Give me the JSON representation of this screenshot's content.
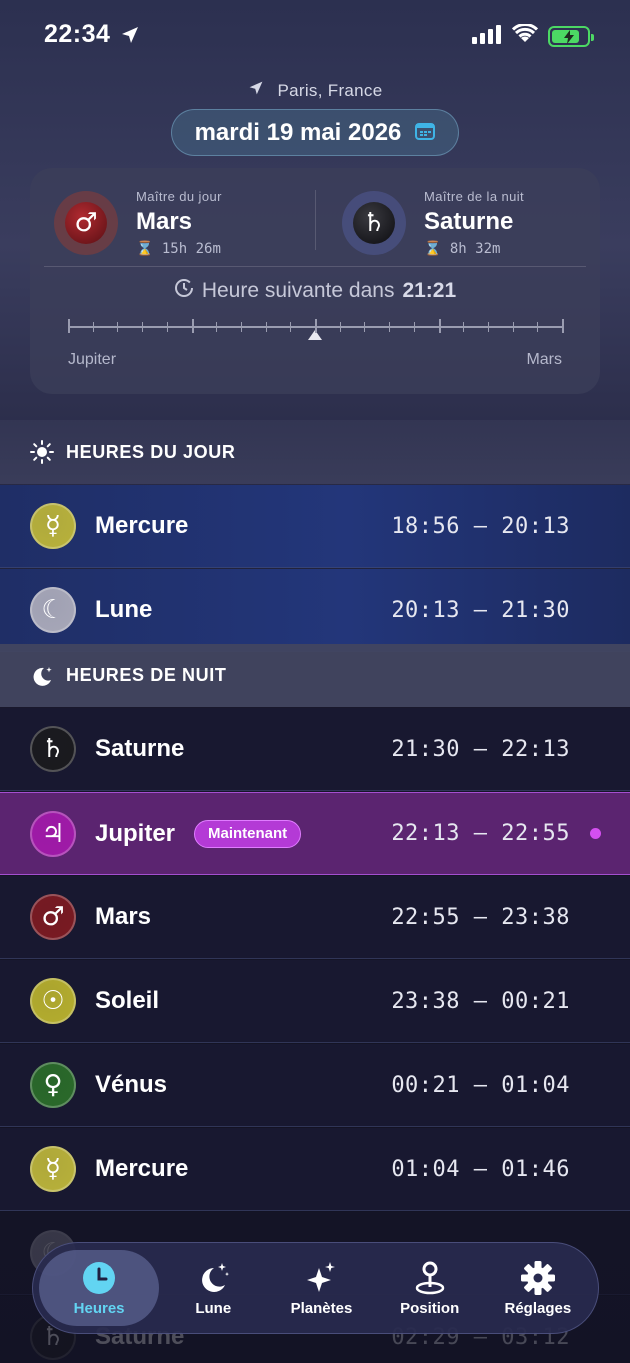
{
  "status": {
    "time": "22:34"
  },
  "location": "Paris, France",
  "date": "mardi 19 mai 2026",
  "rulers": {
    "day": {
      "caption": "Maître du jour",
      "planet": "Mars",
      "symbol": "♂",
      "duration": "15h 26m"
    },
    "night": {
      "caption": "Maître de la nuit",
      "planet": "Saturne",
      "symbol": "♄",
      "duration": "8h 32m"
    }
  },
  "next_hour": {
    "prefix": "Heure suivante dans",
    "countdown": "21:21"
  },
  "timeline": {
    "left_label": "Jupiter",
    "right_label": "Mars",
    "progress": 0.5
  },
  "sections": {
    "day_title": "HEURES DU JOUR",
    "night_title": "HEURES DE NUIT"
  },
  "day_hours": [
    {
      "planet": "Mercure",
      "symbol": "☿",
      "time": "18:56 – 20:13",
      "color": "#b9b23a"
    },
    {
      "planet": "Lune",
      "symbol": "☾",
      "time": "20:13 – 21:30",
      "color": "#a8a8b8"
    }
  ],
  "night_hours": [
    {
      "planet": "Saturne",
      "symbol": "♄",
      "time": "21:30 – 22:13",
      "color": "#1a1a1e"
    },
    {
      "planet": "Jupiter",
      "symbol": "♃",
      "time": "22:13 – 22:55",
      "color": "#a01aa8",
      "badge": "Maintenant"
    },
    {
      "planet": "Mars",
      "symbol": "♂",
      "time": "22:55 – 23:38",
      "color": "#7a1a22"
    },
    {
      "planet": "Soleil",
      "symbol": "☉",
      "time": "23:38 – 00:21",
      "color": "#b5ae2e"
    },
    {
      "planet": "Vénus",
      "symbol": "♀",
      "time": "00:21 – 01:04",
      "color": "#2a6a2a"
    },
    {
      "planet": "Mercure",
      "symbol": "☿",
      "time": "01:04 – 01:46",
      "color": "#b9b23a"
    },
    {
      "planet": "",
      "symbol": "☾",
      "time": "",
      "color": "#a8a8b8"
    },
    {
      "planet": "Saturne",
      "symbol": "♄",
      "time": "02:29 – 03:12",
      "color": "#1a1a1e"
    }
  ],
  "tabs": [
    {
      "label": "Heures",
      "icon": "clock-icon"
    },
    {
      "label": "Lune",
      "icon": "moon-icon"
    },
    {
      "label": "Planètes",
      "icon": "sparkles-icon"
    },
    {
      "label": "Position",
      "icon": "pin-icon"
    },
    {
      "label": "Réglages",
      "icon": "gear-icon"
    }
  ],
  "colors": {
    "accent": "#62d4f2",
    "current_row": "#5b2470",
    "badge": "#b43ad6"
  }
}
